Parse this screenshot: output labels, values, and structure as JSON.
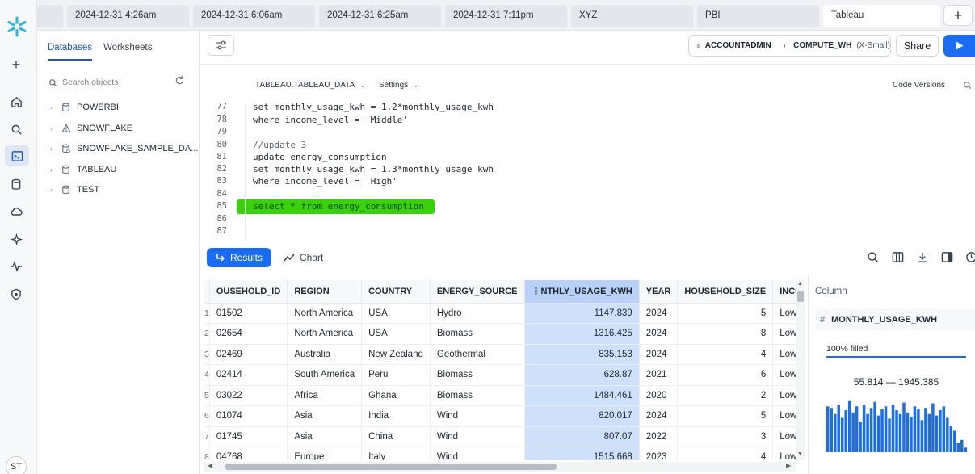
{
  "tabs": [
    {
      "label": ""
    },
    {
      "label": "2024-12-31 4:26am"
    },
    {
      "label": "2024-12-31 6:06am"
    },
    {
      "label": "2024-12-31 6:25am"
    },
    {
      "label": "2024-12-31 7:11pm"
    },
    {
      "label": "XYZ"
    },
    {
      "label": "PBI"
    },
    {
      "label": "Tableau"
    }
  ],
  "sidebar": {
    "tabs": [
      "Databases",
      "Worksheets"
    ],
    "search_placeholder": "Search objects",
    "items": [
      {
        "label": "POWERBI"
      },
      {
        "label": "SNOWFLAKE"
      },
      {
        "label": "SNOWFLAKE_SAMPLE_DA..."
      },
      {
        "label": "TABLEAU"
      },
      {
        "label": "TEST"
      }
    ]
  },
  "user": {
    "initials": "ST"
  },
  "toolbar": {
    "role": "ACCOUNTADMIN",
    "warehouse": "COMPUTE_WH",
    "warehouse_size": "(X-Small)",
    "share_label": "Share"
  },
  "editor": {
    "context": "TABLEAU.TABLEAU_DATA",
    "settings": "Settings",
    "code_versions": "Code Versions",
    "lines": [
      {
        "n": "77",
        "text": "set monthly_usage_kwh = 1.2*monthly_usage_kwh",
        "kind": "code"
      },
      {
        "n": "78",
        "text": "where income_level = 'Middle'",
        "kind": "code"
      },
      {
        "n": "79",
        "text": "",
        "kind": "code"
      },
      {
        "n": "80",
        "text": "//update 3",
        "kind": "comment"
      },
      {
        "n": "81",
        "text": "update energy_consumption",
        "kind": "code"
      },
      {
        "n": "82",
        "text": "set monthly_usage_kwh = 1.3*monthly_usage_kwh",
        "kind": "code"
      },
      {
        "n": "83",
        "text": "where income_level = 'High'",
        "kind": "code"
      },
      {
        "n": "84",
        "text": "",
        "kind": "code"
      },
      {
        "n": "85",
        "text": "select * from energy_consumption",
        "kind": "code"
      },
      {
        "n": "86",
        "text": "",
        "kind": "code"
      },
      {
        "n": "87",
        "text": "",
        "kind": "code"
      }
    ]
  },
  "results": {
    "results_label": "Results",
    "chart_label": "Chart",
    "columns": [
      "OUSEHOLD_ID",
      "REGION",
      "COUNTRY",
      "ENERGY_SOURCE",
      "NTHLY_USAGE_KWH",
      "YEAR",
      "HOUSEHOLD_SIZE",
      "INCO"
    ],
    "rows": [
      [
        "1",
        "01502",
        "North America",
        "USA",
        "Hydro",
        "1147.839",
        "2024",
        "5",
        "Low"
      ],
      [
        "2",
        "02654",
        "North America",
        "USA",
        "Biomass",
        "1316.425",
        "2024",
        "8",
        "Low"
      ],
      [
        "3",
        "02469",
        "Australia",
        "New Zealand",
        "Geothermal",
        "835.153",
        "2024",
        "4",
        "Low"
      ],
      [
        "4",
        "02414",
        "South America",
        "Peru",
        "Biomass",
        "628.87",
        "2021",
        "6",
        "Low"
      ],
      [
        "5",
        "03022",
        "Africa",
        "Ghana",
        "Biomass",
        "1484.461",
        "2020",
        "2",
        "Low"
      ],
      [
        "6",
        "01074",
        "Asia",
        "India",
        "Wind",
        "820.017",
        "2024",
        "5",
        "Low"
      ],
      [
        "7",
        "01745",
        "Asia",
        "China",
        "Wind",
        "807.07",
        "2022",
        "3",
        "Low"
      ],
      [
        "8",
        "04768",
        "Europe",
        "Italy",
        "Wind",
        "1515.668",
        "2023",
        "4",
        "Low"
      ]
    ]
  },
  "column_panel": {
    "title": "Column",
    "name": "MONTHLY_USAGE_KWH",
    "filled": "100% filled",
    "range": "55.814 — 1945.385",
    "histogram_levels": [
      0.6,
      0.58,
      0.5,
      0.62,
      0.45,
      0.55,
      0.68,
      0.52,
      0.6,
      0.4,
      0.62,
      0.5,
      0.58,
      0.66,
      0.48,
      0.56,
      0.6,
      0.44,
      0.62,
      0.55,
      0.5,
      0.65,
      0.52,
      0.46,
      0.6,
      0.56,
      0.42,
      0.58,
      0.5,
      0.64,
      0.48,
      0.55,
      0.6,
      0.45,
      0.34,
      0.28,
      0.12,
      0.16,
      0.06
    ]
  },
  "colors": {
    "accent": "#1a6cf0",
    "highlight": "#39d20a",
    "selected_column": "#cfe0fb"
  }
}
